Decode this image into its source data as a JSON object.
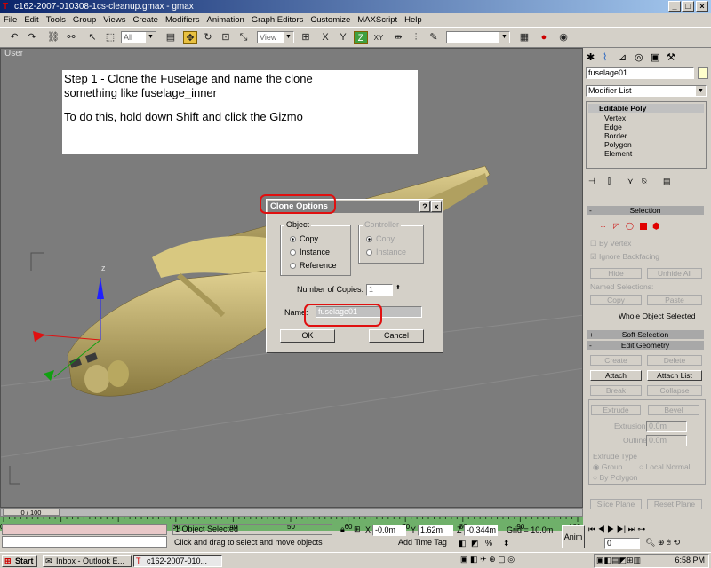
{
  "window": {
    "title": "c162-2007-010308-1cs-cleanup.gmax - gmax"
  },
  "menu": [
    "File",
    "Edit",
    "Tools",
    "Group",
    "Views",
    "Create",
    "Modifiers",
    "Animation",
    "Graph Editors",
    "Customize",
    "MAXScript",
    "Help"
  ],
  "toolbar": {
    "filter_value": "All",
    "refcoord_value": "View",
    "constraint_z": "Z",
    "constraint_xy": "XY"
  },
  "viewport": {
    "label": "User",
    "instructions": [
      "Step 1 - Clone the Fuselage and name the clone",
      "something like fuselage_inner",
      "To do this, hold down Shift and click the Gizmo"
    ],
    "gizmo_label": "z"
  },
  "dialog": {
    "title": "Clone Options",
    "help_btn": "?",
    "close_btn": "×",
    "object_group": "Object",
    "object_options": [
      "Copy",
      "Instance",
      "Reference"
    ],
    "controller_group": "Controller",
    "controller_options": [
      "Copy",
      "Instance"
    ],
    "copies_label": "Number of Copies:",
    "copies_value": "1",
    "name_label": "Name:",
    "name_value": "fuselage01",
    "ok": "OK",
    "cancel": "Cancel"
  },
  "panel": {
    "object_name": "fuselage01",
    "modifier_list": "Modifier List",
    "stack_root": "Editable Poly",
    "stack_items": [
      "Vertex",
      "Edge",
      "Border",
      "Polygon",
      "Element"
    ],
    "selection": {
      "title": "Selection",
      "by_vertex": "By Vertex",
      "ignore_backfacing": "Ignore Backfacing",
      "hide": "Hide",
      "unhide_all": "Unhide All",
      "named_selections": "Named Selections:",
      "copy": "Copy",
      "paste": "Paste",
      "whole_selected": "Whole Object Selected"
    },
    "soft_selection": "Soft Selection",
    "edit_geometry": {
      "title": "Edit Geometry",
      "create": "Create",
      "delete": "Delete",
      "attach": "Attach",
      "attach_list": "Attach List",
      "break": "Break",
      "collapse": "Collapse",
      "extrude": "Extrude",
      "bevel": "Bevel",
      "extrusion": "Extrusion",
      "extrusion_val": "0.0m",
      "outline": "Outline",
      "outline_val": "0.0m",
      "extrude_type": "Extrude Type",
      "group": "Group",
      "local_normal": "Local Normal",
      "by_polygon": "By Polygon",
      "slice_plane": "Slice Plane",
      "reset_plane": "Reset Plane"
    }
  },
  "timeline": {
    "frame": "0 / 100",
    "ticks": [
      "0",
      "10",
      "20",
      "30",
      "40",
      "50",
      "60",
      "70",
      "80",
      "90",
      "100"
    ]
  },
  "status": {
    "selected": "1 Object Selected",
    "prompt": "Click and drag to select and move objects",
    "x_label": "X",
    "x": "-0.0m",
    "y_label": "Y",
    "y": "1.62m",
    "z_label": "Z",
    "z": "-0.344m",
    "grid": "Grid = 10.0m",
    "add_time_tag": "Add Time Tag",
    "anim": "Anim",
    "frame_field": "0"
  },
  "taskbar": {
    "start": "Start",
    "tasks": [
      "Inbox - Outlook E...",
      "c162-2007-010..."
    ],
    "clock": "6:58 PM"
  },
  "colors": {
    "plane": "#c8b468",
    "highlight": "#e01010",
    "viewport_bg": "#7c7c7c"
  }
}
